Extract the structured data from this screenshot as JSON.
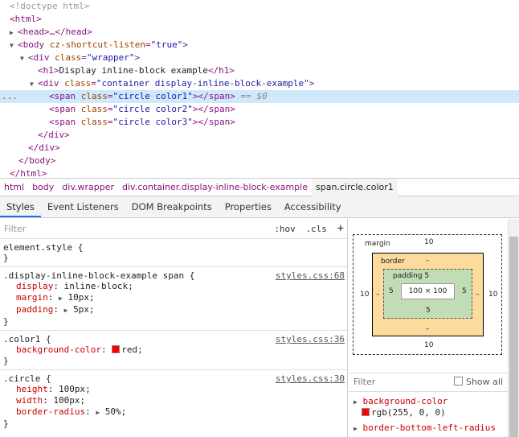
{
  "dom": {
    "doctype": "<!doctype html>",
    "html_open": "<html>",
    "head": "<head>…</head>",
    "body_tag": "body",
    "body_attr": "cz-shortcut-listen",
    "body_val": "\"true\"",
    "wrapper_tag": "div",
    "wrapper_attr": "class",
    "wrapper_val": "\"wrapper\"",
    "h1_text": "Display inline-block example",
    "container_val": "\"container display-inline-block-example\"",
    "span1_val": "\"circle color1\"",
    "span2_val": "\"circle color2\"",
    "span3_val": "\"circle color3\"",
    "selected_marker": "== $0",
    "dots": "..."
  },
  "breadcrumb": [
    "html",
    "body",
    "div.wrapper",
    "div.container.display-inline-block-example",
    "span.circle.color1"
  ],
  "tabs": [
    "Styles",
    "Event Listeners",
    "DOM Breakpoints",
    "Properties",
    "Accessibility"
  ],
  "styles": {
    "filter_placeholder": "Filter",
    "hov": ":hov",
    "cls": ".cls",
    "plus": "+",
    "element_style": "element.style {",
    "close": "}",
    "rule1": {
      "selector": ".display-inline-block-example span {",
      "source": "styles.css:68",
      "decls": [
        {
          "name": "display",
          "value": "inline-block;"
        },
        {
          "name": "margin",
          "value": "10px;"
        },
        {
          "name": "padding",
          "value": "5px;"
        }
      ]
    },
    "rule2": {
      "selector": ".color1 {",
      "source": "styles.css:36",
      "decl_name": "background-color",
      "decl_value": "red;",
      "swatch_color": "#ff0000"
    },
    "rule3": {
      "selector": ".circle {",
      "source": "styles.css:30",
      "decls": [
        {
          "name": "height",
          "value": "100px;"
        },
        {
          "name": "width",
          "value": "100px;"
        },
        {
          "name": "border-radius",
          "value": "50%;"
        }
      ]
    }
  },
  "boxmodel": {
    "margin_label": "margin",
    "margin_top": "10",
    "margin_bottom": "10",
    "margin_left": "10",
    "margin_right": "10",
    "border_label": "border",
    "border_top": "–",
    "border_bottom": "–",
    "border_left": "–",
    "border_right": "–",
    "padding_label": "padding 5",
    "padding_bottom": "5",
    "padding_left": "5",
    "padding_right": "5",
    "content": "100 × 100"
  },
  "computed": {
    "filter_placeholder": "Filter",
    "show_all": "Show all",
    "prop1_name": "background-color",
    "prop1_value": "rgb(255, 0, 0)",
    "prop2_name": "border-bottom-left-radius"
  }
}
